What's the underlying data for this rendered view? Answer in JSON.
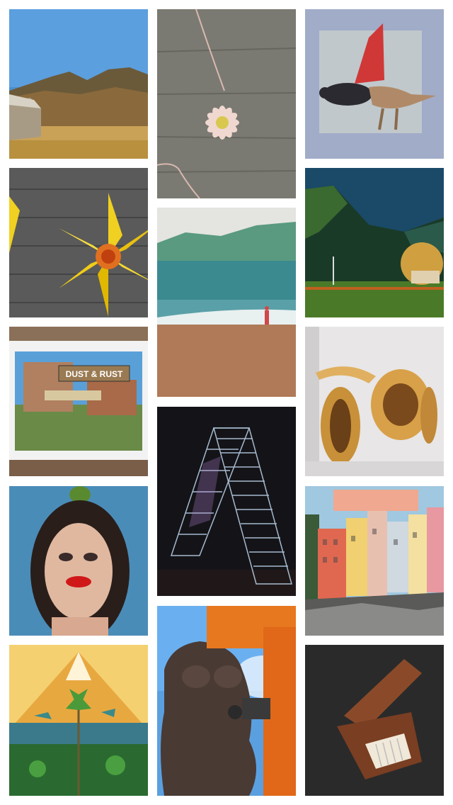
{
  "gallery": {
    "tiles": [
      {
        "id": "mountain-landscape-with-hut"
      },
      {
        "id": "flower-pendant-necklace"
      },
      {
        "id": "rat-dragon-hybrid-art"
      },
      {
        "id": "yellow-daffodil-pinwheels"
      },
      {
        "id": "beach-painting-with-figure"
      },
      {
        "id": "green-hills-caravan-landscape"
      },
      {
        "id": "dust-and-rust-sign-painting",
        "visible_text": "DUST & RUST"
      },
      {
        "id": "turned-wood-spiral-sculpture"
      },
      {
        "id": "acrylic-staircase-sculpture"
      },
      {
        "id": "portrait-red-lips-painting"
      },
      {
        "id": "cinque-terre-houses-painting"
      },
      {
        "id": "mountain-palm-birds-painting"
      },
      {
        "id": "stone-torso-carving"
      },
      {
        "id": "wooden-music-box"
      }
    ]
  }
}
